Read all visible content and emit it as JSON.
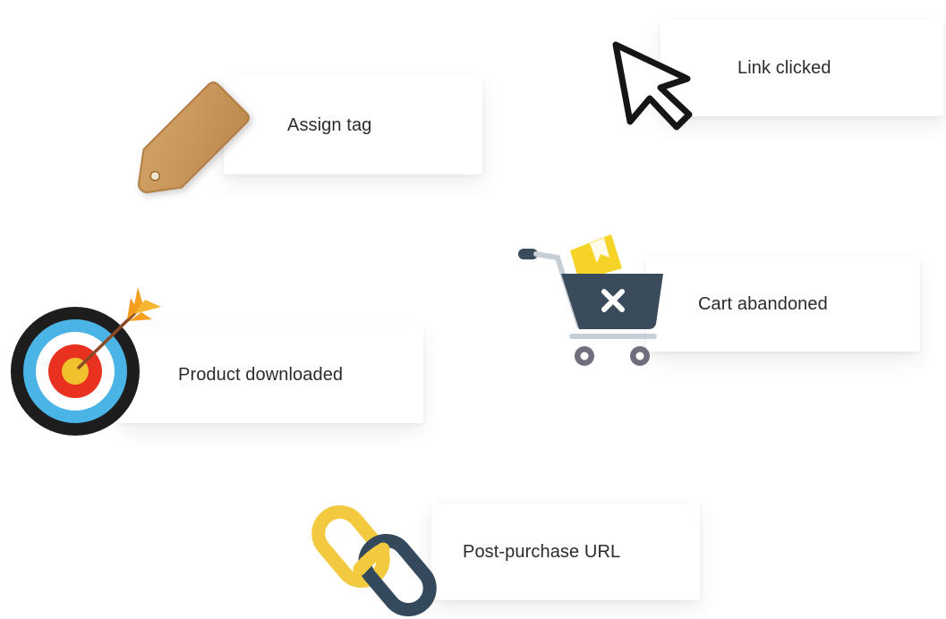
{
  "cards": {
    "assign_tag": {
      "label": "Assign tag",
      "icon": "tag-icon"
    },
    "link_clicked": {
      "label": "Link clicked",
      "icon": "cursor-icon"
    },
    "cart_abandoned": {
      "label": "Cart abandoned",
      "icon": "cart-icon"
    },
    "product_downloaded": {
      "label": "Product downloaded",
      "icon": "target-icon"
    },
    "post_purchase_url": {
      "label": "Post-purchase URL",
      "icon": "link-icon"
    }
  },
  "colors": {
    "tag": "#c8975a",
    "cart_body": "#3a4b5c",
    "cart_box": "#f5d327",
    "target_outer": "#1d1d1d",
    "target_blue": "#4ab4e6",
    "target_red": "#e8321f",
    "target_yellow": "#f2c12e",
    "link_yellow": "#f3c93f",
    "link_navy": "#34495c"
  }
}
